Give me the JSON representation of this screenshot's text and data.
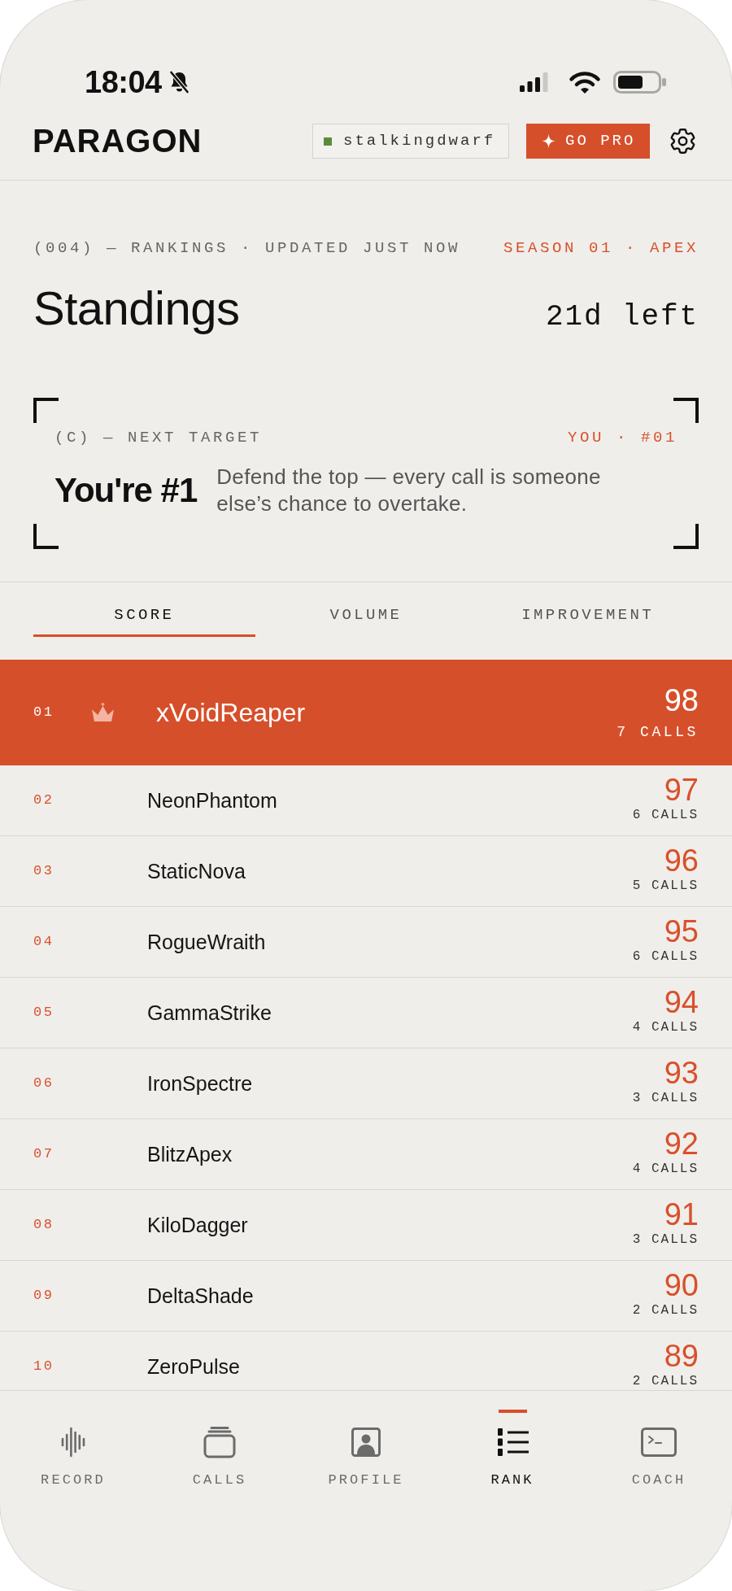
{
  "status_bar": {
    "time": "18:04"
  },
  "header": {
    "logo": "PARAGON",
    "account_chip": {
      "username": "stalkingdwarf"
    },
    "pro_button": {
      "label": "GO PRO"
    }
  },
  "rankings": {
    "eyebrow": "(004) — RANKINGS · UPDATED JUST NOW",
    "season": "SEASON 01 · APEX",
    "title": "Standings",
    "time_left": "21d left"
  },
  "target_card": {
    "eyebrow": "(C) — NEXT TARGET",
    "position": "YOU · #01",
    "headline": "You're #1",
    "message": "Defend the top — every call is someone else’s chance to overtake."
  },
  "tabs": [
    {
      "label": "SCORE",
      "selected": true
    },
    {
      "label": "VOLUME",
      "selected": false
    },
    {
      "label": "IMPROVEMENT",
      "selected": false
    }
  ],
  "leaderboard": {
    "rows": [
      {
        "rank": "01",
        "name": "xVoidReaper",
        "score": "98",
        "calls": "7 CALLS",
        "highlighted": true,
        "crown": true
      },
      {
        "rank": "02",
        "name": "NeonPhantom",
        "score": "97",
        "calls": "6 CALLS",
        "highlighted": false,
        "crown": false
      },
      {
        "rank": "03",
        "name": "StaticNova",
        "score": "96",
        "calls": "5 CALLS",
        "highlighted": false,
        "crown": false
      },
      {
        "rank": "04",
        "name": "RogueWraith",
        "score": "95",
        "calls": "6 CALLS",
        "highlighted": false,
        "crown": false
      },
      {
        "rank": "05",
        "name": "GammaStrike",
        "score": "94",
        "calls": "4 CALLS",
        "highlighted": false,
        "crown": false
      },
      {
        "rank": "06",
        "name": "IronSpectre",
        "score": "93",
        "calls": "3 CALLS",
        "highlighted": false,
        "crown": false
      },
      {
        "rank": "07",
        "name": "BlitzApex",
        "score": "92",
        "calls": "4 CALLS",
        "highlighted": false,
        "crown": false
      },
      {
        "rank": "08",
        "name": "KiloDagger",
        "score": "91",
        "calls": "3 CALLS",
        "highlighted": false,
        "crown": false
      },
      {
        "rank": "09",
        "name": "DeltaShade",
        "score": "90",
        "calls": "2 CALLS",
        "highlighted": false,
        "crown": false
      },
      {
        "rank": "10",
        "name": "ZeroPulse",
        "score": "89",
        "calls": "2 CALLS",
        "highlighted": false,
        "crown": false
      }
    ]
  },
  "bottom_nav": [
    {
      "label": "RECORD",
      "selected": false
    },
    {
      "label": "CALLS",
      "selected": false
    },
    {
      "label": "PROFILE",
      "selected": false
    },
    {
      "label": "RANK",
      "selected": true
    },
    {
      "label": "COACH",
      "selected": false
    }
  ]
}
